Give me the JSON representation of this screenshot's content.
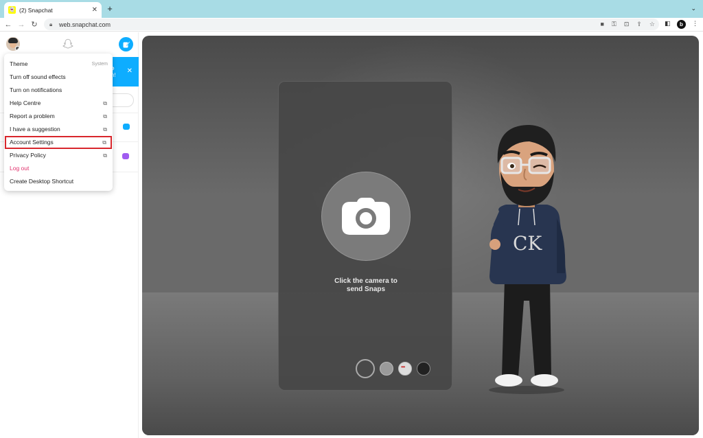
{
  "browser": {
    "tab_title": "(2) Snapchat",
    "tab_close": "✕",
    "new_tab": "+",
    "tab_menu": "⌄",
    "url": "web.snapchat.com",
    "back": "←",
    "forward": "→",
    "reload": "↻",
    "profile_initial": "b"
  },
  "sidebar": {
    "promo_line1": "e",
    "promo_line2": "n!",
    "promo_close": "✕"
  },
  "menu": {
    "items": [
      {
        "label": "Theme",
        "hint": "System"
      },
      {
        "label": "Turn off sound effects"
      },
      {
        "label": "Turn on notifications"
      },
      {
        "label": "Help Centre",
        "ext": "⧉"
      },
      {
        "label": "Report a problem",
        "ext": "⧉"
      },
      {
        "label": "I have a suggestion",
        "ext": "⧉"
      },
      {
        "label": "Account Settings",
        "ext": "⧉"
      },
      {
        "label": "Privacy Policy",
        "ext": "⧉"
      },
      {
        "label": "Log out"
      },
      {
        "label": "Create Desktop Shortcut"
      }
    ]
  },
  "camera": {
    "line1": "Click the camera to",
    "line2": "send Snaps"
  },
  "colors": {
    "snap_blue": "#0eadff",
    "highlight_red": "#d8262c",
    "logout_pink": "#e1306c",
    "tabbar": "#a8dce5"
  }
}
